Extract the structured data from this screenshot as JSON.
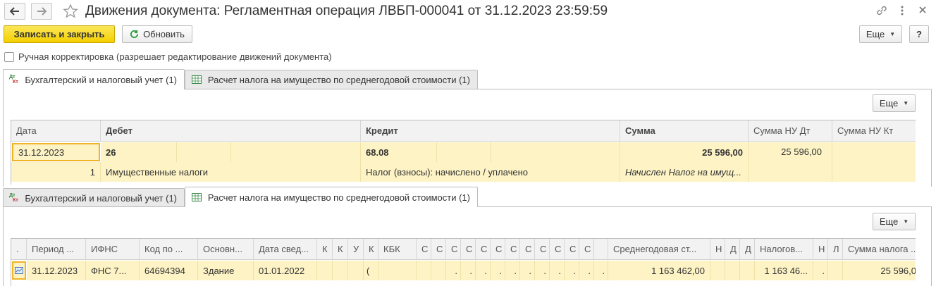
{
  "window": {
    "title": "Движения документа: Регламентная операция ЛВБП-000041 от 31.12.2023 23:59:59",
    "nav_back_icon": "arrow-left-icon",
    "nav_forward_icon": "arrow-right-icon",
    "favorite_icon": "star-icon",
    "link_icon": "link-icon",
    "more_icon": "vertical-dots-icon",
    "close_icon": "close-icon"
  },
  "toolbar": {
    "save_close_label": "Записать и закрыть",
    "refresh_label": "Обновить",
    "more_label": "Еще",
    "help_label": "?"
  },
  "manual_correction": {
    "label": "Ручная корректировка (разрешает редактирование движений документа)",
    "checked": false
  },
  "tabs": [
    {
      "label": "Бухгалтерский и налоговый учет (1)",
      "icon": "dt-kt-icon"
    },
    {
      "label": "Расчет налога на имущество по среднегодовой стоимости (1)",
      "icon": "register-grid-icon"
    }
  ],
  "panel_more_label": "Еще",
  "accounting": {
    "headers": {
      "date": "Дата",
      "debit": "Дебет",
      "credit": "Кредит",
      "amount": "Сумма",
      "amount_nu_dt": "Сумма НУ Дт",
      "amount_nu_kt": "Сумма НУ Кт"
    },
    "row": {
      "date": "31.12.2023",
      "line_no": "1",
      "debit_account": "26",
      "debit_subconto": "Имущественные налоги",
      "credit_account": "68.08",
      "credit_subconto": "Налог (взносы): начислено / уплачено",
      "amount": "25 596,00",
      "content": "Начислен Налог на имущ...",
      "amount_nu_dt": "25 596,00",
      "amount_nu_kt": ""
    }
  },
  "property_tax": {
    "headers": {
      "marker": ".",
      "period": "Период ...",
      "ifns": "ИФНС",
      "code": "Код по ...",
      "basis": "Основн...",
      "date_info": "Дата свед...",
      "k1": "К",
      "k2": "К",
      "u": "У",
      "k3": "К",
      "kbk": "КБК",
      "s1": "С",
      "s2": "С",
      "s3": "С",
      "s4": "С",
      "s5": "С",
      "s6": "С",
      "s7": "С",
      "s8": "С",
      "s9": "С",
      "s10": "С",
      "s11": "С",
      "s12": "С",
      "avg_cost": "Среднегодовая ст...",
      "n1": "Н",
      "d1": "Д",
      "d2": "Д",
      "tax_base": "Налогов...",
      "n2": "Н",
      "l1": "Л",
      "tax_amount": "Сумма налога ..."
    },
    "row": {
      "period": "31.12.2023",
      "ifns": "ФНС 7...",
      "code": "64694394",
      "basis": "Здание",
      "date_info": "01.01.2022",
      "k3": "(",
      "dots": ".",
      "avg_cost": "1 163 462,00",
      "tax_base": "1 163 46...",
      "n2": ".",
      "tax_amount": "25 596,0"
    }
  }
}
